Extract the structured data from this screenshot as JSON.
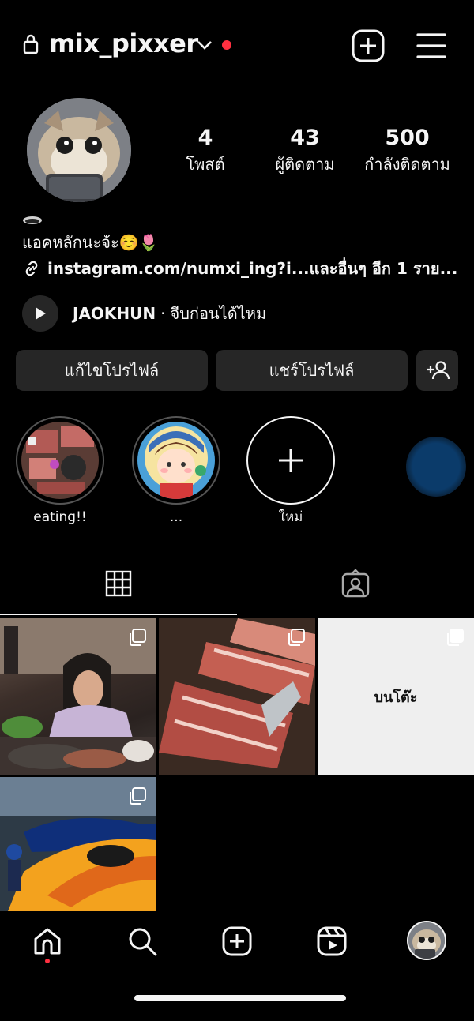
{
  "header": {
    "username": "mix_pixxer",
    "lock_icon": "lock-icon",
    "dropdown_icon": "chevron-down-icon",
    "notification_dot_color": "#ff3040",
    "create_icon": "plus-square-icon",
    "menu_icon": "hamburger-menu-icon"
  },
  "profile": {
    "stats": [
      {
        "value": "4",
        "label": "โพสต์"
      },
      {
        "value": "43",
        "label": "ผู้ติดตาม"
      },
      {
        "value": "500",
        "label": "กำลังติดตาม"
      }
    ],
    "bio": "แอคหลักนะจ้ะ☺️🌷",
    "link": "instagram.com/numxi_ing?i...และอื่นๆ อีก 1 ราย...",
    "music": {
      "artist": "JAOKHUN",
      "separator": "·",
      "title": "จีบก่อนได้ไหม"
    }
  },
  "buttons": {
    "edit_profile": "แก้ไขโปรไฟล์",
    "share_profile": "แชร์โปรไฟล์",
    "discover_icon": "add-person-icon"
  },
  "highlights": [
    {
      "label": "eating!!"
    },
    {
      "label": "..."
    },
    {
      "label": "ใหม่",
      "icon": "plus-icon"
    }
  ],
  "tabs": [
    {
      "name": "posts-grid",
      "icon": "grid-icon",
      "active": true
    },
    {
      "name": "tagged",
      "icon": "tagged-person-icon",
      "active": false
    }
  ],
  "posts": [
    {
      "kind": "photo-carousel",
      "caption": ""
    },
    {
      "kind": "photo-carousel",
      "caption": ""
    },
    {
      "kind": "text-carousel",
      "caption": "บนโต๊ะ"
    },
    {
      "kind": "photo-carousel",
      "caption": ""
    }
  ],
  "bottom_nav": [
    {
      "name": "home",
      "icon": "home-icon",
      "active": true
    },
    {
      "name": "search",
      "icon": "search-icon"
    },
    {
      "name": "create",
      "icon": "plus-square-icon"
    },
    {
      "name": "reels",
      "icon": "reels-icon"
    },
    {
      "name": "profile",
      "icon": "avatar"
    }
  ],
  "colors": {
    "background": "#000000",
    "button": "#262626",
    "accent_red": "#ff3040",
    "text": "#f5f5f5"
  }
}
